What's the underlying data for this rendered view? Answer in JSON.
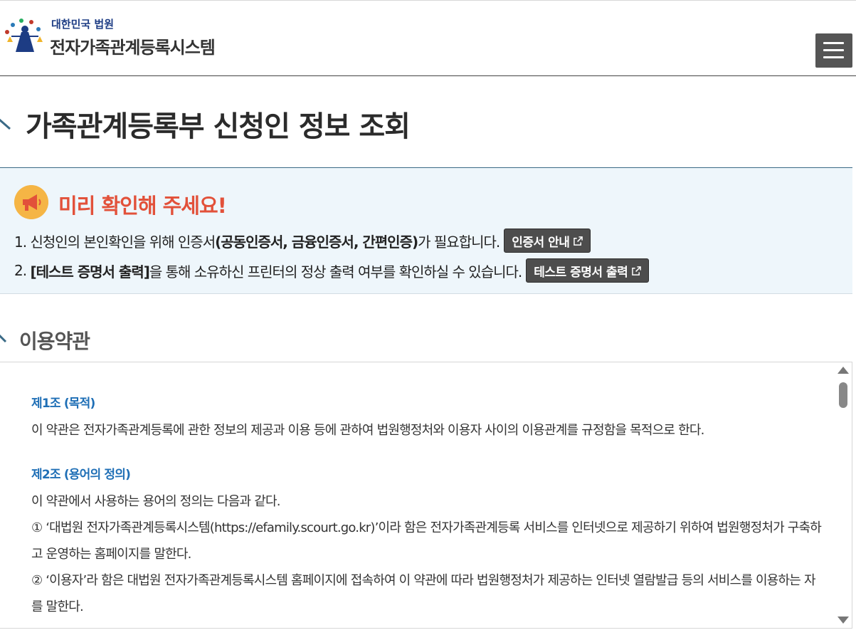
{
  "header": {
    "org_name": "대한민국 법원",
    "system_name": "전자가족관계등록시스템"
  },
  "page": {
    "title": "가족관계등록부 신청인 정보 조회"
  },
  "notice": {
    "title": "미리 확인해 주세요!",
    "line1_prefix": "1. 신청인의 본인확인을 위해 인증서",
    "line1_bold": "(공동인증서, 금융인증서, 간편인증)",
    "line1_suffix": "가 필요합니다.",
    "line1_button": "인증서 안내",
    "line2_prefix": "2.",
    "line2_bold": "[테스트 증명서 출력]",
    "line2_suffix": "을 통해 소유하신 프린터의 정상 출력 여부를 확인하실 수 있습니다.",
    "line2_button": "테스트 증명서 출력"
  },
  "terms": {
    "title": "이용약관",
    "articles": [
      {
        "heading": "제1조 (목적)",
        "paragraphs": [
          "이 약관은 전자가족관계등록에 관한 정보의 제공과 이용 등에 관하여 법원행정처와 이용자 사이의 이용관계를 규정함을 목적으로 한다."
        ]
      },
      {
        "heading": "제2조 (용어의 정의)",
        "paragraphs": [
          "이 약관에서 사용하는 용어의 정의는 다음과 같다.",
          "① ‘대법원 전자가족관계등록시스템(https://efamily.scourt.go.kr)’이라 함은 전자가족관계등록 서비스를 인터넷으로 제공하기 위하여 법원행정처가 구축하고 운영하는 홈페이지를 말한다.",
          "② ‘이용자’라 함은 대법원 전자가족관계등록시스템 홈페이지에 접속하여 이 약관에 따라 법원행정처가 제공하는 인터넷 열람발급 등의 서비스를 이용하는 자를 말한다."
        ]
      }
    ]
  },
  "colors": {
    "accent_blue": "#1f6fb6",
    "notice_red": "#e2513a",
    "notice_bg": "#eef6fb",
    "button_dark": "#4d4d4d"
  },
  "icons": {
    "logo": "court-logo-icon",
    "menu": "hamburger-menu-icon",
    "notice": "megaphone-icon",
    "external": "external-link-icon"
  }
}
